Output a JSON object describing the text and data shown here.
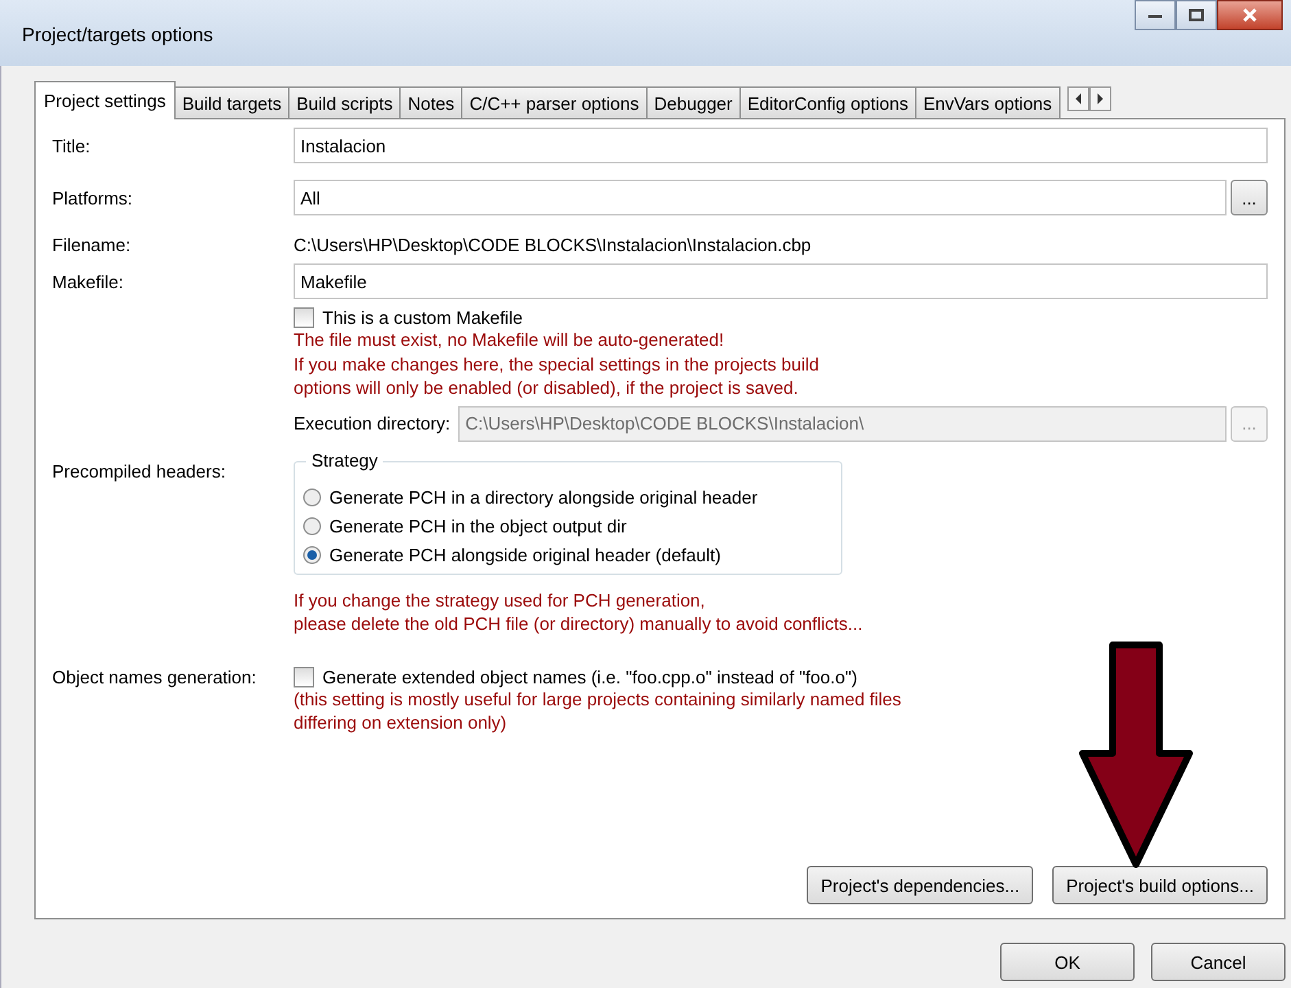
{
  "window": {
    "title": "Project/targets options"
  },
  "tabs": [
    {
      "label": "Project settings",
      "selected": true
    },
    {
      "label": "Build targets",
      "selected": false
    },
    {
      "label": "Build scripts",
      "selected": false
    },
    {
      "label": "Notes",
      "selected": false
    },
    {
      "label": "C/C++ parser options",
      "selected": false
    },
    {
      "label": "Debugger",
      "selected": false
    },
    {
      "label": "EditorConfig options",
      "selected": false
    },
    {
      "label": "EnvVars options",
      "selected": false
    }
  ],
  "form": {
    "title": {
      "label": "Title:",
      "value": "Instalacion"
    },
    "platforms": {
      "label": "Platforms:",
      "value": "All",
      "browse": "..."
    },
    "filename": {
      "label": "Filename:",
      "value": "C:\\Users\\HP\\Desktop\\CODE BLOCKS\\Instalacion\\Instalacion.cbp"
    },
    "makefile": {
      "label": "Makefile:",
      "value": "Makefile"
    },
    "custom_makefile": {
      "label": "This is a custom Makefile",
      "checked": false
    },
    "makefile_notes": [
      "The file must exist, no Makefile will be auto-generated!",
      "If you make changes here, the special settings in the projects build",
      "options will only be enabled (or disabled), if the project is saved."
    ],
    "execution_directory": {
      "label": "Execution directory:",
      "value": "C:\\Users\\HP\\Desktop\\CODE BLOCKS\\Instalacion\\",
      "disabled": true,
      "browse": "..."
    },
    "precompiled_headers": {
      "label": "Precompiled headers:",
      "group_title": "Strategy",
      "options": [
        {
          "label": "Generate PCH in a directory alongside original header",
          "selected": false
        },
        {
          "label": "Generate PCH in the object output dir",
          "selected": false
        },
        {
          "label": "Generate PCH alongside original header (default)",
          "selected": true
        }
      ],
      "notes": [
        "If you change the strategy used for PCH generation,",
        "please delete the old PCH file (or directory) manually to avoid conflicts..."
      ]
    },
    "object_names": {
      "label": "Object names generation:",
      "checkbox": {
        "label": "Generate extended object names (i.e. \"foo.cpp.o\" instead of \"foo.o\")",
        "checked": false
      },
      "notes": [
        "(this setting is mostly useful for large projects containing similarly named files",
        "differing on extension only)"
      ]
    },
    "buttons": [
      "Project's dependencies...",
      "Project's build options..."
    ]
  },
  "dialog_buttons": [
    "OK",
    "Cancel"
  ]
}
